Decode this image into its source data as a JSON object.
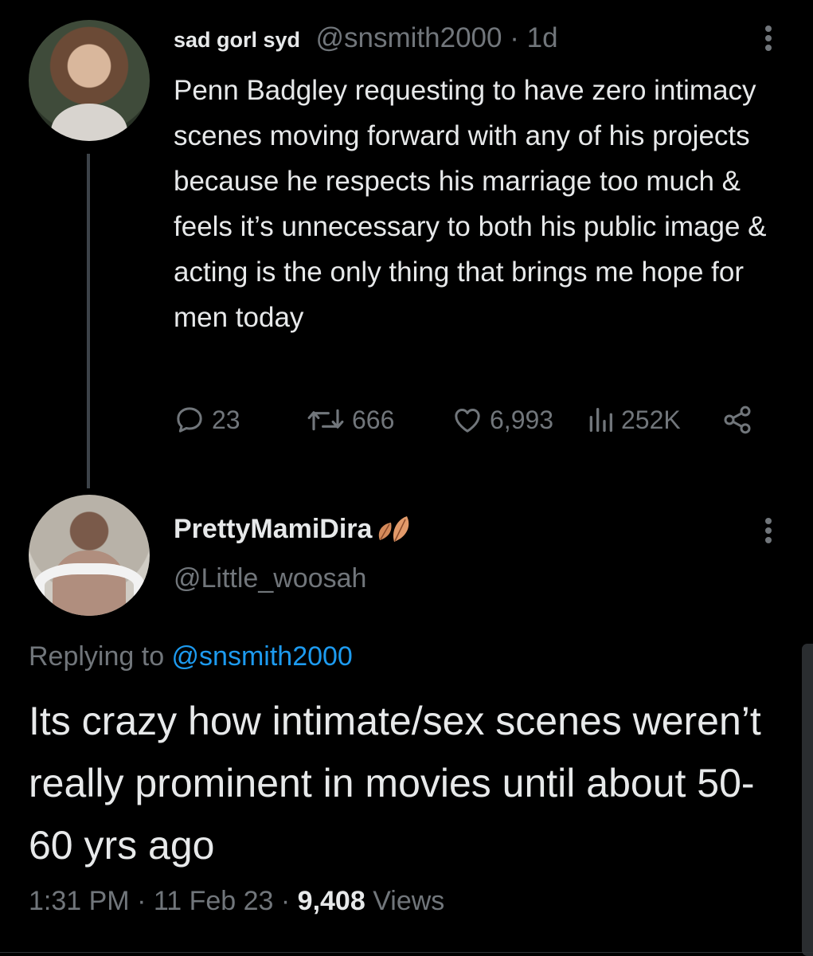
{
  "tweet1": {
    "display_name": "sad gorl syd",
    "handle": "@snsmith2000",
    "separator": " · ",
    "age": "1d",
    "text": "Penn Badgley requesting to have zero intimacy scenes moving forward with any of his projects because he respects his marriage too much & feels it’s unnecessary to both his public image & acting is the only thing that brings me hope for men today",
    "actions": {
      "replies": "23",
      "retweets": "666",
      "likes": "6,993",
      "views": "252K"
    }
  },
  "tweet2": {
    "display_name": "PrettyMamiDira",
    "handle": "@Little_woosah",
    "replying_prefix": "Replying to ",
    "replying_to": "@snsmith2000",
    "text": "Its crazy how intimate/sex scenes weren’t really prominent in movies until about 50-60 yrs ago",
    "time": "1:31 PM",
    "sep1": " · ",
    "date": "11 Feb 23",
    "sep2": " · ",
    "views_count": "9,408",
    "views_label": " Views"
  },
  "icons": {
    "reply": "reply-icon",
    "retweet": "retweet-icon",
    "like": "heart-icon",
    "views": "analytics-icon",
    "share": "share-icon",
    "more": "more-icon",
    "name_emoji": "leaves-emoji-icon"
  },
  "colors": {
    "background": "#000000",
    "text": "#e7e9ea",
    "muted": "#71767b",
    "link": "#1d9bf0",
    "thread_line": "#3d4349"
  }
}
